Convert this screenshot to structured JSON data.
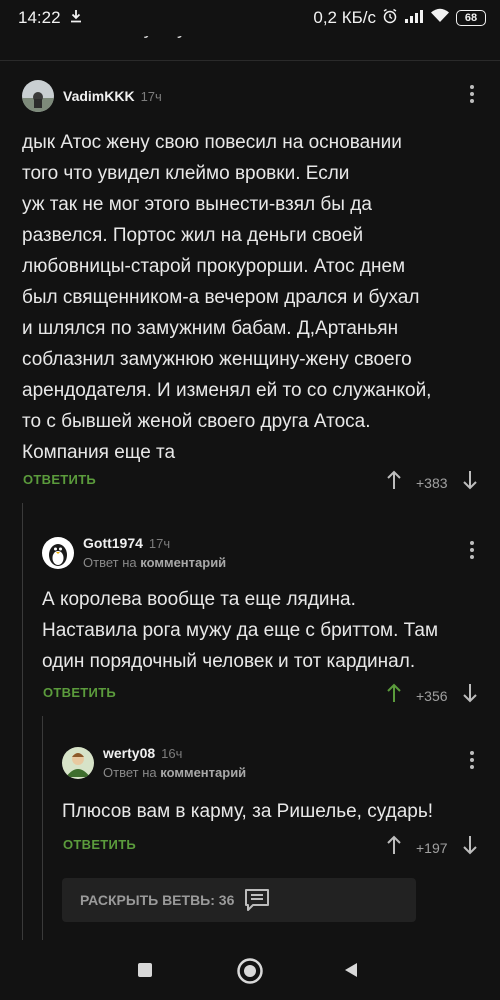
{
  "status_bar": {
    "time": "14:22",
    "download_icon": "download-icon",
    "speed": "0,2 КБ/с",
    "battery": "68"
  },
  "comments": [
    {
      "username": "VadimKKK",
      "time": "17ч",
      "text": "дык Атос жену свою повесил на основании\nтого что увидел клеймо врoвки. Если\nуж так не мог этого вынести-взял бы да\nразвелся. Портос жил на деньги своей\nлюбовницы-старой прокурорши. Атос днем\nбыл священником-а вечером дрался и бухал\nи шлялся по замужним бабам. Д,Артаньян\nсоблазнил замужнюю женщину-жену своего\nарендодателя. И изменял ей то со служанкой,\nто с бывшей женой своего друга Атоса.\nКомпания еще та",
      "reply_label": "ОТВЕТИТЬ",
      "score": "+383"
    },
    {
      "username": "Gott1974",
      "time": "17ч",
      "reply_prefix": "Ответ на",
      "reply_target": "комментарий",
      "text": "А королева вообще та еще лядина.\nНаставила рога мужу да еще с бриттом. Там\nодин порядочный человек и тот кардинал.",
      "reply_label": "ОТВЕТИТЬ",
      "score": "+356"
    },
    {
      "username": "werty08",
      "time": "16ч",
      "reply_prefix": "Ответ на",
      "reply_target": "комментарий",
      "text": "Плюсов вам в карму, за Ришелье, сударь!",
      "reply_label": "ОТВЕТИТЬ",
      "score": "+197"
    }
  ],
  "expand_branch": {
    "label": "РАСКРЫТЬ ВЕТВЬ: 36",
    "icon": "comment-icon"
  },
  "colors": {
    "background": "#121212",
    "accent_green": "#5b9b3c",
    "text": "#e8e8e8"
  }
}
